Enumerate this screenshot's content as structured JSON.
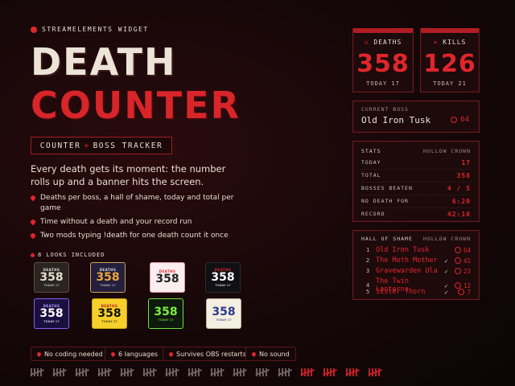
{
  "header": {
    "eyebrow": "STREAMELEMENTS WIDGET",
    "title_line1": "DEATH",
    "title_line2": "COUNTER",
    "tag_left": "COUNTER",
    "tag_plus": "+",
    "tag_right": "BOSS TRACKER"
  },
  "description": "Every death gets its moment: the number rolls up and a banner hits the screen.",
  "bullets": [
    "Deaths per boss, a hall of shame, today and total per game",
    "Time without a death and your record run",
    "Two mods typing !death for one death count it once"
  ],
  "looks_label": "8 LOOKS INCLUDED",
  "looks": [
    {
      "label": "DEATHS",
      "value": "358",
      "sub": "TODAY 17"
    },
    {
      "label": "DEATHS",
      "value": "358",
      "sub": "TODAY 17"
    },
    {
      "label": "DEATHS",
      "value": "358",
      "sub": ""
    },
    {
      "label": "DEATHS",
      "value": "358",
      "sub": "TODAY 17"
    },
    {
      "label": "DEATHS",
      "value": "358",
      "sub": "TODAY 17"
    },
    {
      "label": "DEATHS",
      "value": "358",
      "sub": "TODAY 17"
    },
    {
      "label": "",
      "value": "358",
      "sub": "TODAY 17"
    },
    {
      "label": "",
      "value": "358",
      "sub": "TODAY 17"
    }
  ],
  "pills": [
    "No coding needed",
    "6 languages",
    "Survives OBS restarts",
    "No sound"
  ],
  "deaths_card": {
    "label": "DEATHS",
    "value": "358",
    "today": "TODAY 17"
  },
  "kills_card": {
    "label": "KILLS",
    "value": "126",
    "today": "TODAY 21"
  },
  "current_boss": {
    "label": "CURRENT BOSS",
    "name": "Old Iron Tusk",
    "count": "64"
  },
  "stats": {
    "title": "STATS",
    "game": "HOLLOW CROWN",
    "rows": [
      {
        "k": "TODAY",
        "v": "17"
      },
      {
        "k": "TOTAL",
        "v": "358"
      },
      {
        "k": "BOSSES BEATEN",
        "v": "4 / 5"
      },
      {
        "k": "NO DEATH FOR",
        "v": "6:20"
      },
      {
        "k": "RECORD",
        "v": "42:10"
      }
    ]
  },
  "hall": {
    "title": "HALL OF SHAME",
    "game": "HOLLOW CROWN",
    "rows": [
      {
        "i": "1",
        "name": "Old Iron Tusk",
        "count": "64",
        "check": ""
      },
      {
        "i": "2",
        "name": "The Moth Mother",
        "count": "41",
        "check": "✓"
      },
      {
        "i": "3",
        "name": "Gravewarden Ula",
        "count": "23",
        "check": "✓"
      },
      {
        "i": "4",
        "name": "The Twin Lanterns",
        "count": "12",
        "check": "✓"
      },
      {
        "i": "5",
        "name": "Sister Thorn",
        "count": "7",
        "check": "✓"
      }
    ]
  },
  "colors": {
    "accent": "#e0262c",
    "background": "#150708",
    "cream": "#ece4d6"
  }
}
